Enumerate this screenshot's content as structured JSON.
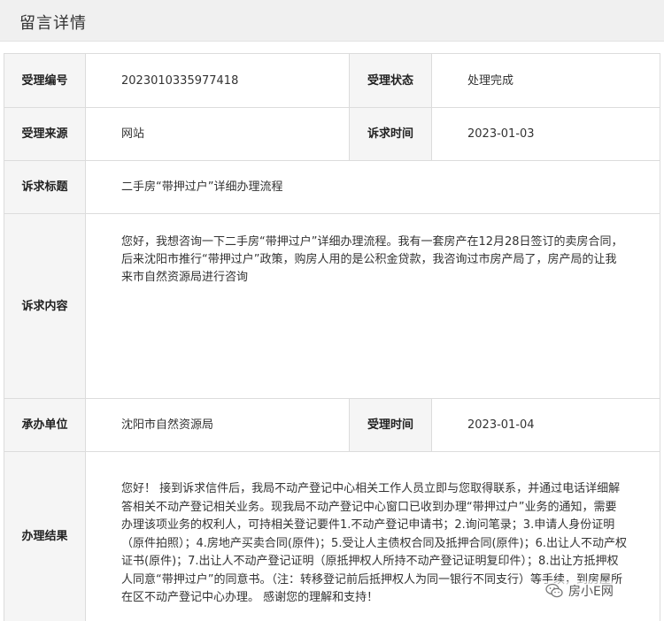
{
  "header": {
    "title": "留言详情"
  },
  "labels": {
    "accept_no": "受理编号",
    "accept_status": "受理状态",
    "source": "受理来源",
    "appeal_time": "诉求时间",
    "appeal_title": "诉求标题",
    "appeal_content": "诉求内容",
    "handling_unit": "承办单位",
    "accept_time": "受理时间",
    "result": "办理结果"
  },
  "values": {
    "accept_no": "2023010335977418",
    "accept_status": "处理完成",
    "source": "网站",
    "appeal_time": "2023-01-03",
    "appeal_title": "二手房“带押过户”详细办理流程",
    "appeal_content": "您好，我想咨询一下二手房“带押过户”详细办理流程。我有一套房产在12月28日签订的卖房合同，后来沈阳市推行“带押过户”政策，购房人用的是公积金贷款，我咨询过市房产局了，房产局的让我来市自然资源局进行咨询",
    "handling_unit": "沈阳市自然资源局",
    "accept_time": "2023-01-04",
    "result": "您好！ 接到诉求信件后，我局不动产登记中心相关工作人员立即与您取得联系，并通过电话详细解答相关不动产登记相关业务。现我局不动产登记中心窗口已收到办理“带押过户”业务的通知，需要办理该项业务的权利人，可持相关登记要件1.不动产登记申请书；2.询问笔录；3.申请人身份证明（原件拍照）；4.房地产买卖合同(原件)；5.受让人主债权合同及抵押合同(原件)；6.出让人不动产权证书(原件)；7.出让人不动产登记证明（原抵押权人所持不动产登记证明复印件）；8.出让方抵押权人同意“带押过户”的同意书。（注：转移登记前后抵押权人为同一银行不同支行）等手续，到房屋所在区不动产登记中心办理。 感谢您的理解和支持！"
  },
  "watermark": {
    "text": "房小E网",
    "icon": "wechat-icon"
  }
}
